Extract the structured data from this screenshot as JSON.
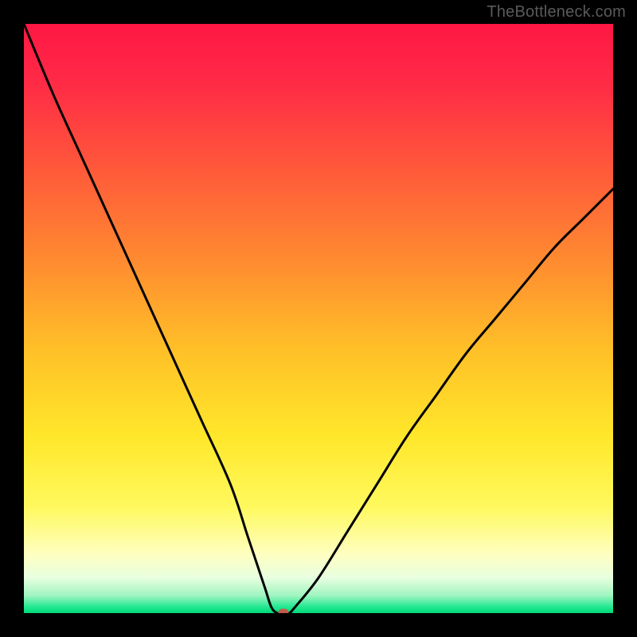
{
  "watermark": "TheBottleneck.com",
  "chart_data": {
    "type": "line",
    "title": "",
    "xlabel": "",
    "ylabel": "",
    "xlim": [
      0,
      100
    ],
    "ylim": [
      0,
      100
    ],
    "series": [
      {
        "name": "bottleneck-curve",
        "x": [
          0,
          5,
          10,
          15,
          20,
          25,
          30,
          35,
          38,
          40,
          41,
          42,
          43,
          44,
          45,
          46,
          50,
          55,
          60,
          65,
          70,
          75,
          80,
          85,
          90,
          95,
          100
        ],
        "values": [
          100,
          88,
          77,
          66,
          55,
          44,
          33,
          22,
          13,
          7,
          4,
          1,
          0,
          0,
          0,
          1,
          6,
          14,
          22,
          30,
          37,
          44,
          50,
          56,
          62,
          67,
          72
        ]
      }
    ],
    "marker": {
      "x": 44,
      "y": 0,
      "color": "#c55a4a"
    },
    "gradient_stops": [
      {
        "offset": 0.0,
        "color": "#ff1744"
      },
      {
        "offset": 0.1,
        "color": "#ff2a46"
      },
      {
        "offset": 0.25,
        "color": "#ff5a3a"
      },
      {
        "offset": 0.4,
        "color": "#ff8a30"
      },
      {
        "offset": 0.55,
        "color": "#ffbf28"
      },
      {
        "offset": 0.7,
        "color": "#ffe72a"
      },
      {
        "offset": 0.82,
        "color": "#fff95e"
      },
      {
        "offset": 0.9,
        "color": "#ffffc0"
      },
      {
        "offset": 0.94,
        "color": "#e8ffe0"
      },
      {
        "offset": 0.97,
        "color": "#a0f5c0"
      },
      {
        "offset": 0.99,
        "color": "#20e890"
      },
      {
        "offset": 1.0,
        "color": "#00d878"
      }
    ],
    "frame_color": "#000000",
    "curve_color": "#000000"
  }
}
